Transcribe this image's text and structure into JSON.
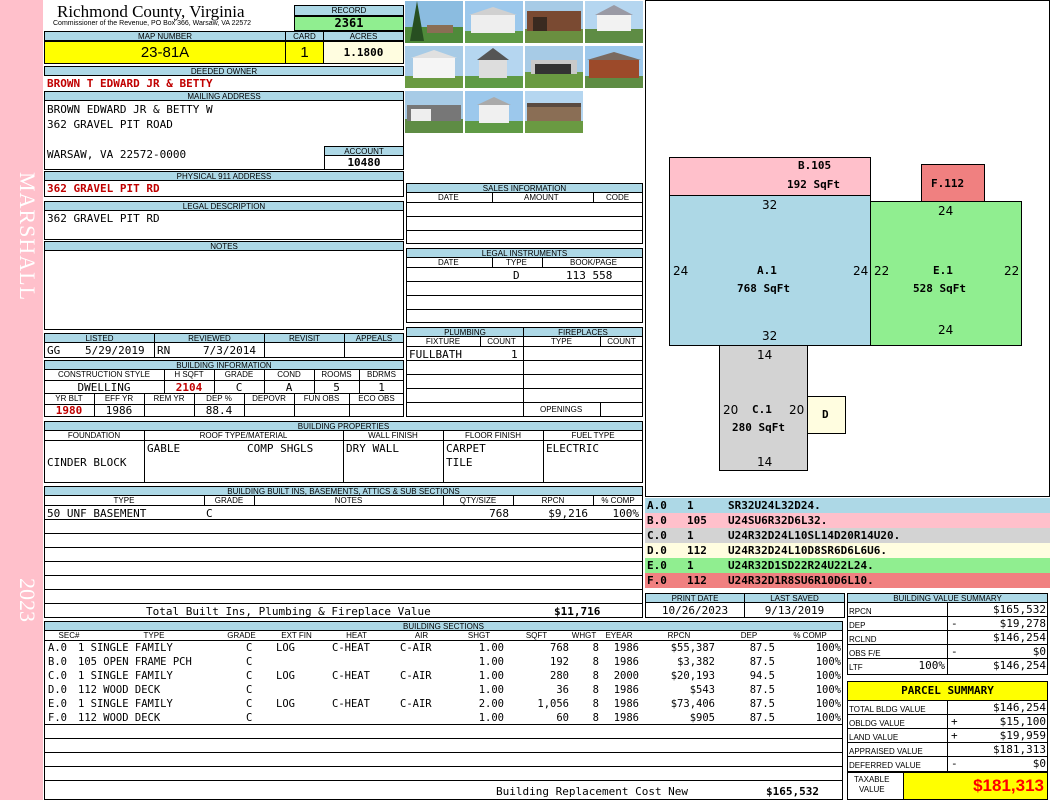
{
  "side_banner": {
    "area": "MARSHALL",
    "year": "2023"
  },
  "header": {
    "county": "Richmond County, Virginia",
    "commissioner": "Commissioner of the Revenue, PO Box 366, Warsaw, VA 22572",
    "record_label": "RECORD",
    "record": "2361",
    "map_number_label": "MAP NUMBER",
    "map_number": "23-81A",
    "card_label": "CARD",
    "card": "1",
    "acres_label": "ACRES",
    "acres": "1.1800"
  },
  "owner": {
    "deeded_owner_label": "DEEDED OWNER",
    "deeded_owner": "BROWN T EDWARD JR & BETTY",
    "mailing_label": "MAILING ADDRESS",
    "mail1": "BROWN EDWARD JR & BETTY W",
    "mail2": "362 GRAVEL PIT ROAD",
    "mail3": "WARSAW, VA 22572-0000",
    "account_label": "ACCOUNT",
    "account": "10480",
    "phys_label": "PHYSICAL 911 ADDRESS",
    "phys": "362 GRAVEL PIT RD",
    "legal_label": "LEGAL DESCRIPTION",
    "legal": "362 GRAVEL PIT RD",
    "notes_label": "NOTES"
  },
  "sales": {
    "title": "SALES INFORMATION",
    "cols": [
      "DATE",
      "AMOUNT",
      "CODE"
    ]
  },
  "legal_instruments": {
    "title": "LEGAL INSTRUMENTS",
    "cols": [
      "DATE",
      "TYPE",
      "BOOK/PAGE"
    ],
    "type": "D",
    "bookpage": "113 558"
  },
  "plumbing": {
    "title": "PLUMBING",
    "cols": [
      "FIXTURE",
      "COUNT"
    ],
    "fixture": "FULLBATH",
    "count": "1"
  },
  "fireplaces": {
    "title": "FIREPLACES",
    "cols": [
      "TYPE",
      "COUNT"
    ],
    "openings": "OPENINGS"
  },
  "listed": {
    "listed_label": "LISTED",
    "reviewed_label": "REVIEWED",
    "revisit_label": "REVISIT",
    "appeals_label": "APPEALS",
    "listed_by": "GG",
    "listed_date": "5/29/2019",
    "reviewed_by": "RN",
    "reviewed_date": "7/3/2014"
  },
  "building_info": {
    "title": "BUILDING INFORMATION",
    "cols": [
      "CONSTRUCTION STYLE",
      "H SQFT",
      "GRADE",
      "COND",
      "ROOMS",
      "BDRMS"
    ],
    "style": "DWELLING",
    "hsqft": "2104",
    "grade": "C",
    "cond": "A",
    "rooms": "5",
    "bdrms": "1",
    "cols2": [
      "YR BLT",
      "EFF YR",
      "REM YR",
      "DEP %",
      "DEPOVR",
      "FUN OBS",
      "ECO OBS"
    ],
    "yrblt": "1980",
    "effyr": "1986",
    "dep": "88.4"
  },
  "properties": {
    "title": "BUILDING PROPERTIES",
    "cols": [
      "FOUNDATION",
      "ROOF TYPE/MATERIAL",
      "WALL FINISH",
      "FLOOR FINISH",
      "FUEL TYPE"
    ],
    "foundation": "CINDER BLOCK",
    "roof_type": "GABLE",
    "roof_mat": "COMP SHGLS",
    "wall": "DRY WALL",
    "floor1": "CARPET",
    "floor2": "TILE",
    "fuel": "ELECTRIC"
  },
  "builtins": {
    "title": "BUILDING BUILT INS, BASEMENTS, ATTICS & SUB SECTIONS",
    "cols": [
      "TYPE",
      "GRADE",
      "NOTES",
      "QTY/SIZE",
      "RPCN",
      "% COMP"
    ],
    "rows": [
      {
        "type": "50 UNF BASEMENT",
        "grade": "C",
        "notes": "",
        "qty": "768",
        "rpcn": "$9,216",
        "comp": "100%"
      }
    ],
    "total_label": "Total Built Ins, Plumbing & Fireplace Value",
    "total": "$11,716"
  },
  "dates": {
    "print_label": "PRINT DATE",
    "print": "10/26/2023",
    "saved_label": "LAST SAVED",
    "saved": "9/13/2019"
  },
  "sections": {
    "title": "BUILDING SECTIONS",
    "cols": [
      "SEC#",
      "TYPE",
      "GRADE",
      "EXT FIN",
      "HEAT",
      "AIR",
      "SHGT",
      "SQFT",
      "WHGT",
      "EYEAR",
      "RPCN",
      "DEP",
      "% COMP"
    ],
    "rows": [
      {
        "sec": "A.0",
        "type": "1 SINGLE FAMILY",
        "grade": "C",
        "ext": "LOG",
        "heat": "C-HEAT",
        "air": "C-AIR",
        "shgt": "1.00",
        "sqft": "768",
        "whgt": "8",
        "eyear": "1986",
        "rpcn": "$55,387",
        "dep": "87.5",
        "comp": "100%"
      },
      {
        "sec": "B.0",
        "type": "105 OPEN FRAME PCH",
        "grade": "C",
        "ext": "",
        "heat": "",
        "air": "",
        "shgt": "1.00",
        "sqft": "192",
        "whgt": "8",
        "eyear": "1986",
        "rpcn": "$3,382",
        "dep": "87.5",
        "comp": "100%"
      },
      {
        "sec": "C.0",
        "type": "1 SINGLE FAMILY",
        "grade": "C",
        "ext": "LOG",
        "heat": "C-HEAT",
        "air": "C-AIR",
        "shgt": "1.00",
        "sqft": "280",
        "whgt": "8",
        "eyear": "2000",
        "rpcn": "$20,193",
        "dep": "94.5",
        "comp": "100%"
      },
      {
        "sec": "D.0",
        "type": "112 WOOD DECK",
        "grade": "C",
        "ext": "",
        "heat": "",
        "air": "",
        "shgt": "1.00",
        "sqft": "36",
        "whgt": "8",
        "eyear": "1986",
        "rpcn": "$543",
        "dep": "87.5",
        "comp": "100%"
      },
      {
        "sec": "E.0",
        "type": "1 SINGLE FAMILY",
        "grade": "C",
        "ext": "LOG",
        "heat": "C-HEAT",
        "air": "C-AIR",
        "shgt": "2.00",
        "sqft": "1,056",
        "whgt": "8",
        "eyear": "1986",
        "rpcn": "$73,406",
        "dep": "87.5",
        "comp": "100%"
      },
      {
        "sec": "F.0",
        "type": "112 WOOD DECK",
        "grade": "C",
        "ext": "",
        "heat": "",
        "air": "",
        "shgt": "1.00",
        "sqft": "60",
        "whgt": "8",
        "eyear": "1986",
        "rpcn": "$905",
        "dep": "87.5",
        "comp": "100%"
      }
    ],
    "brcn_label": "Building Replacement Cost New",
    "brcn": "$165,532"
  },
  "sketch": {
    "areas": [
      {
        "id": "B",
        "label": "B.105",
        "sqft": "192 SqFt",
        "color": "#ffc0cb"
      },
      {
        "id": "F",
        "label": "F.112",
        "sqft": "",
        "color": "#f08080"
      },
      {
        "id": "A",
        "label": "A.1",
        "sqft": "768 SqFt",
        "color": "#add8e6"
      },
      {
        "id": "E",
        "label": "E.1",
        "sqft": "528 SqFt",
        "color": "#90ee90"
      },
      {
        "id": "C",
        "label": "C.1",
        "sqft": "280 SqFt",
        "color": "#d3d3d3"
      },
      {
        "id": "D",
        "label": "D",
        "sqft": "",
        "color": "#fffde0"
      }
    ],
    "dims": {
      "a_top": "32",
      "a_left": "24",
      "a_right": "24",
      "a_bottom": "32",
      "e_top": "24",
      "e_left": "22",
      "e_right": "22",
      "e_bottom": "24",
      "c_top": "14",
      "c_left": "20",
      "c_right": "20",
      "c_bottom": "14"
    }
  },
  "vectors": [
    {
      "sec": "A.0",
      "num": "1",
      "vec": "SR32U24L32D24.",
      "color": "#add8e6"
    },
    {
      "sec": "B.0",
      "num": "105",
      "vec": "U24SU6R32D6L32.",
      "color": "#ffc0cb"
    },
    {
      "sec": "C.0",
      "num": "1",
      "vec": "U24R32D24L10SL14D20R14U20.",
      "color": "#d3d3d3"
    },
    {
      "sec": "D.0",
      "num": "112",
      "vec": "U24R32D24L10D8SR6D6L6U6.",
      "color": "#fffde0"
    },
    {
      "sec": "E.0",
      "num": "1",
      "vec": "U24R32D1SD22R24U22L24.",
      "color": "#90ee90"
    },
    {
      "sec": "F.0",
      "num": "112",
      "vec": "U24R32D1R8SU6R10D6L10.",
      "color": "#f08080"
    }
  ],
  "value_summary": {
    "title": "BUILDING VALUE SUMMARY",
    "rpcn_label": "RPCN",
    "rpcn": "$165,532",
    "dep_label": "DEP",
    "dep_sign": "-",
    "dep": "$19,278",
    "rclnd_label": "RCLND",
    "rclnd": "$146,254",
    "obs_label": "OBS F/E",
    "obs_sign": "-",
    "obs": "$0",
    "ltf_label": "LTF",
    "ltf_pct": "100%",
    "ltf": "$146,254"
  },
  "parcel": {
    "title": "PARCEL SUMMARY",
    "tbv_label": "TOTAL BLDG VALUE",
    "tbv": "$146,254",
    "obldg_label": "OBLDG VALUE",
    "obldg_sign": "+",
    "obldg": "$15,100",
    "land_label": "LAND VALUE",
    "land_sign": "+",
    "land": "$19,959",
    "appraised_label": "APPRAISED VALUE",
    "appraised": "$181,313",
    "deferred_label": "DEFERRED VALUE",
    "deferred_sign": "-",
    "deferred": "$0",
    "taxable_label1": "TAXABLE",
    "taxable_label2": "VALUE",
    "taxable": "$181,313"
  }
}
